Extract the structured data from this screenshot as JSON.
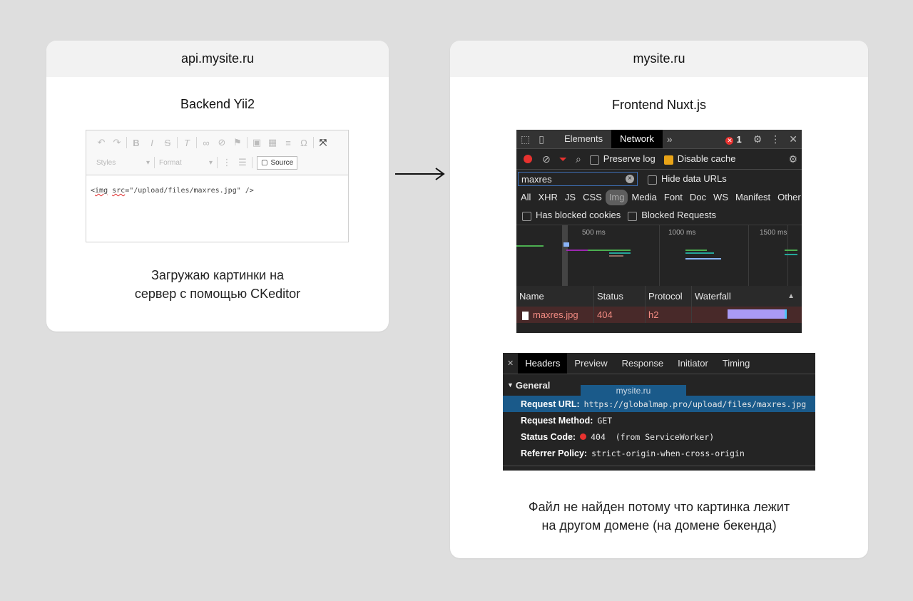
{
  "left_card": {
    "title": "api.mysite.ru",
    "subtitle": "Backend  Yii2",
    "editor": {
      "styles_label": "Styles",
      "format_label": "Format",
      "source_label": "Source",
      "content_prefix": "<",
      "content_tag": "img",
      "content_attr": "src",
      "content_rest": "=\"/upload/files/maxres.jpg\" />"
    },
    "caption_line1": "Загружаю картинки на",
    "caption_line2": "сервер с помощью CKeditor"
  },
  "right_card": {
    "title": "mysite.ru",
    "subtitle": "Frontend  Nuxt.js",
    "devtools": {
      "tabs": [
        "Elements",
        "Network"
      ],
      "more": "»",
      "error_count": "1",
      "preserve_log": "Preserve log",
      "disable_cache": "Disable cache",
      "filter_value": "maxres",
      "hide_data_urls": "Hide data URLs",
      "types": [
        "All",
        "XHR",
        "JS",
        "CSS",
        "Img",
        "Media",
        "Font",
        "Doc",
        "WS",
        "Manifest",
        "Other"
      ],
      "has_blocked_cookies": "Has blocked cookies",
      "blocked_requests": "Blocked Requests",
      "ticks": [
        "500 ms",
        "1000 ms",
        "1500 ms"
      ],
      "columns": [
        "Name",
        "Status",
        "Protocol",
        "Waterfall"
      ],
      "row": {
        "name": "maxres.jpg",
        "status": "404",
        "protocol": "h2"
      }
    },
    "headers_panel": {
      "tabs": [
        "Headers",
        "Preview",
        "Response",
        "Initiator",
        "Timing"
      ],
      "general": "General",
      "overlay": "mysite.ru",
      "request_url_key": "Request URL:",
      "request_url_val": "https://globalmap.pro/upload/files/maxres.jpg",
      "method_key": "Request Method:",
      "method_val": "GET",
      "status_key": "Status Code:",
      "status_val": "404  (from ServiceWorker)",
      "referrer_key": "Referrer Policy:",
      "referrer_val": "strict-origin-when-cross-origin"
    },
    "caption_line1": "Файл не найден потому что картинка лежит",
    "caption_line2": "на другом домене (на домене бекенда)"
  },
  "colors": {
    "background": "#dedede",
    "card": "#ffffff",
    "card_header": "#f2f2f2",
    "devtools_bg": "#242424",
    "error_red": "#e8322f",
    "selection_blue": "#1a5a8a"
  }
}
